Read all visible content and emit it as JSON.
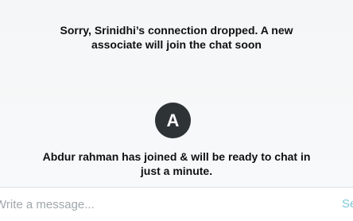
{
  "messages": {
    "connection_dropped": "Sorry, Srinidhi’s connection dropped. A new associate will join the chat soon",
    "agent_joined": "Abdur rahman has joined & will be ready to chat in just a minute."
  },
  "agent": {
    "avatar_initial": "A"
  },
  "composer": {
    "placeholder": "Write a message...",
    "value": "",
    "send_label": "Send"
  },
  "colors": {
    "background": "#f6f8f9",
    "avatar_bg": "#2e3336",
    "text": "#0f1111",
    "send_accent": "#7fc8d8"
  }
}
